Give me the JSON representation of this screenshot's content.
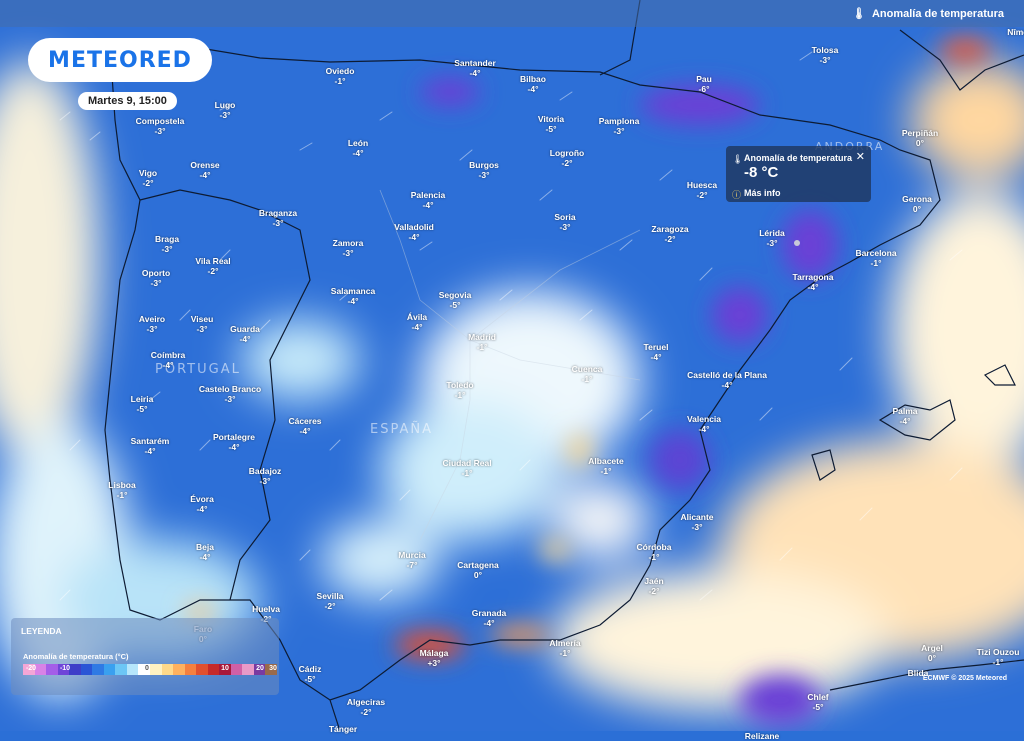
{
  "header": {
    "layer_label": "Anomalía de temperatura"
  },
  "logo": {
    "text": "METEORED"
  },
  "date": "Martes 9, 15:00",
  "popup": {
    "title": "Anomalía de temperatura",
    "value": "-8 °C",
    "more": "Más info",
    "close": "✕"
  },
  "countries": [
    {
      "name": "PORTUGAL"
    },
    {
      "name": "ESPAÑA"
    },
    {
      "name": "ANDORRA"
    }
  ],
  "cities": [
    {
      "name": "Oviedo",
      "value": "-1°"
    },
    {
      "name": "Santander",
      "value": "-4°"
    },
    {
      "name": "Bilbao",
      "value": "-4°"
    },
    {
      "name": "Pau",
      "value": "-6°"
    },
    {
      "name": "Tolosa",
      "value": "-3°"
    },
    {
      "name": "Lugo",
      "value": "-3°"
    },
    {
      "name": "Compostela",
      "value": "-3°"
    },
    {
      "name": "Vitoria",
      "value": "-5°"
    },
    {
      "name": "Pamplona",
      "value": "-3°"
    },
    {
      "name": "Perpiñán",
      "value": "0°"
    },
    {
      "name": "León",
      "value": "-4°"
    },
    {
      "name": "Logroño",
      "value": "-2°"
    },
    {
      "name": "Orense",
      "value": "-4°"
    },
    {
      "name": "Burgos",
      "value": "-3°"
    },
    {
      "name": "Vigo",
      "value": "-2°"
    },
    {
      "name": "Huesca",
      "value": "-2°"
    },
    {
      "name": "Gerona",
      "value": "0°"
    },
    {
      "name": "Palencia",
      "value": "-4°"
    },
    {
      "name": "Braganza",
      "value": "-3°"
    },
    {
      "name": "Soria",
      "value": "-3°"
    },
    {
      "name": "Valladolid",
      "value": "-4°"
    },
    {
      "name": "Zaragoza",
      "value": "-2°"
    },
    {
      "name": "Lérida",
      "value": "-3°"
    },
    {
      "name": "Braga",
      "value": "-3°"
    },
    {
      "name": "Zamora",
      "value": "-3°"
    },
    {
      "name": "Barcelona",
      "value": "-1°"
    },
    {
      "name": "Vila Real",
      "value": "-2°"
    },
    {
      "name": "Tarragona",
      "value": "-4°"
    },
    {
      "name": "Oporto",
      "value": "-3°"
    },
    {
      "name": "Salamanca",
      "value": "-4°"
    },
    {
      "name": "Segovia",
      "value": "-5°"
    },
    {
      "name": "Aveiro",
      "value": "-3°"
    },
    {
      "name": "Viseu",
      "value": "-3°"
    },
    {
      "name": "Guarda",
      "value": "-4°"
    },
    {
      "name": "Ávila",
      "value": "-4°"
    },
    {
      "name": "Madrid",
      "value": "-1°"
    },
    {
      "name": "Teruel",
      "value": "-4°"
    },
    {
      "name": "Coímbra",
      "value": "-4°"
    },
    {
      "name": "Cuenca",
      "value": "-1°"
    },
    {
      "name": "Castelló de la Plana",
      "value": "-4°"
    },
    {
      "name": "Castelo Branco",
      "value": "-3°"
    },
    {
      "name": "Toledo",
      "value": "-1°"
    },
    {
      "name": "Leiria",
      "value": "-5°"
    },
    {
      "name": "Palma",
      "value": "-4°"
    },
    {
      "name": "Cáceres",
      "value": "-4°"
    },
    {
      "name": "Valencia",
      "value": "-4°"
    },
    {
      "name": "Portalegre",
      "value": "-4°"
    },
    {
      "name": "Santarém",
      "value": "-4°"
    },
    {
      "name": "Ciudad Real",
      "value": "-1°"
    },
    {
      "name": "Albacete",
      "value": "-1°"
    },
    {
      "name": "Badajoz",
      "value": "-3°"
    },
    {
      "name": "Lisboa",
      "value": "-1°"
    },
    {
      "name": "Évora",
      "value": "-4°"
    },
    {
      "name": "Alicante",
      "value": "-3°"
    },
    {
      "name": "Beja",
      "value": "-4°"
    },
    {
      "name": "Córdoba",
      "value": "-1°"
    },
    {
      "name": "Murcia",
      "value": "-7°"
    },
    {
      "name": "Jaén",
      "value": "-2°"
    },
    {
      "name": "Cartagena",
      "value": "0°"
    },
    {
      "name": "Sevilla",
      "value": "-2°"
    },
    {
      "name": "Huelva",
      "value": "-2°"
    },
    {
      "name": "Granada",
      "value": "-4°"
    },
    {
      "name": "Faro",
      "value": "0°"
    },
    {
      "name": "Almería",
      "value": "-1°"
    },
    {
      "name": "Málaga",
      "value": "+3°"
    },
    {
      "name": "Argel",
      "value": "0°"
    },
    {
      "name": "Tizi Ouzou",
      "value": "-1°"
    },
    {
      "name": "Cádiz",
      "value": "-5°"
    },
    {
      "name": "Blida",
      "value": ""
    },
    {
      "name": "Algeciras",
      "value": "-2°"
    },
    {
      "name": "Chlef",
      "value": "-5°"
    },
    {
      "name": "Tánger",
      "value": ""
    },
    {
      "name": "Nîmes",
      "value": ""
    },
    {
      "name": "Relizane",
      "value": ""
    }
  ],
  "legend": {
    "title": "LEYENDA",
    "unit": "Anomalía de temperatura (°C)",
    "labels": [
      "-20",
      "-10",
      "0",
      "10",
      "20",
      "30"
    ],
    "colors": [
      "#f4a6d6",
      "#d882e6",
      "#a45ee8",
      "#6f45d8",
      "#3e3ec8",
      "#2a55d6",
      "#2f7ae4",
      "#3aa0ef",
      "#6cc6f5",
      "#b6e6fb",
      "#ffffff",
      "#fff2c2",
      "#ffd98a",
      "#ffb15e",
      "#f5803e",
      "#e0502f",
      "#c62a2a",
      "#a8183a",
      "#d060a6",
      "#e89ac8",
      "#7a3aa0",
      "#9a6a4a"
    ]
  },
  "credit": "ECMWF © 2025 Meteored"
}
